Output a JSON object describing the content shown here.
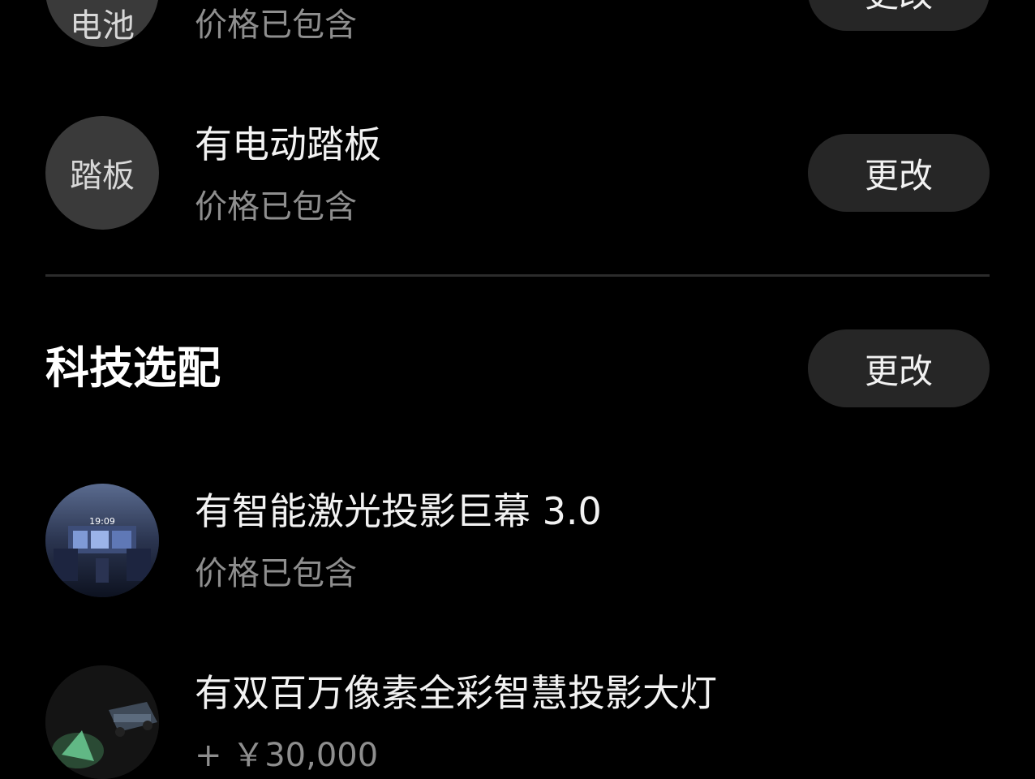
{
  "items_top": [
    {
      "icon_text": "电池",
      "subtitle": "价格已包含",
      "button": "更改"
    },
    {
      "icon_text": "踏板",
      "title": "有电动踏板",
      "subtitle": "价格已包含",
      "button": "更改"
    }
  ],
  "tech_section": {
    "title": "科技选配",
    "button": "更改",
    "items": [
      {
        "title": "有智能激光投影巨幕 3.0",
        "subtitle": "价格已包含",
        "thumb_icon": "projection-screen-interior-icon",
        "thumb_time": "19:09"
      },
      {
        "title": "有双百万像素全彩智慧投影大灯",
        "subtitle": "+ ￥30,000",
        "thumb_icon": "headlight-projection-car-icon"
      }
    ]
  },
  "colors": {
    "background": "#000000",
    "icon_circle": "#3a3a3a",
    "button_bg": "#262626",
    "subtitle": "#8e8e8e",
    "divider": "#2c2c2c"
  }
}
